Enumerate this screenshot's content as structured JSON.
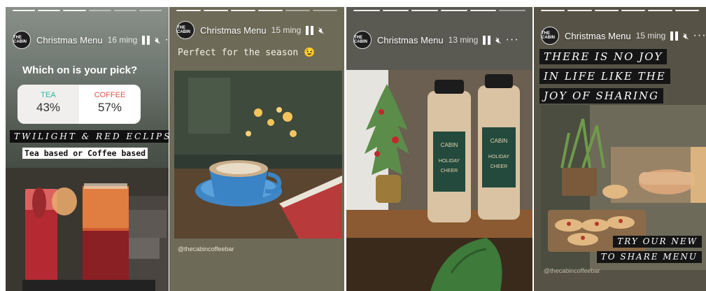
{
  "stories": [
    {
      "title": "Christmas Menu",
      "time": "16 ming",
      "question": "Which on is your pick?",
      "poll": {
        "left_label": "TEA",
        "left_pct": "43%",
        "right_label": "COFFEE",
        "right_pct": "57%"
      },
      "banner": "TWILIGHT & RED ECLIPSE",
      "subtitle": "Tea based or Coffee based"
    },
    {
      "title": "Christmas Menu",
      "time": "15 ming",
      "caption": "Perfect for the season 😉",
      "handle": "@thecabincoffeebar"
    },
    {
      "title": "Christmas Menu",
      "time": "13 ming"
    },
    {
      "title": "Christmas Menu",
      "time": "15 ming",
      "quote_lines": [
        "THERE IS NO JOY",
        "IN LIFE LIKE THE",
        "JOY OF SHARING"
      ],
      "cta_lines": [
        "TRY OUR NEW",
        "TO SHARE MENU"
      ],
      "handle": "@thecabincoffeebar"
    }
  ],
  "icons": {
    "pause": "pause-icon",
    "mute": "mute-icon",
    "more": "more-icon",
    "avatar": "the-cabin-logo"
  },
  "colors": {
    "tea": "#2bb5a0",
    "coffee": "#e0514a"
  }
}
